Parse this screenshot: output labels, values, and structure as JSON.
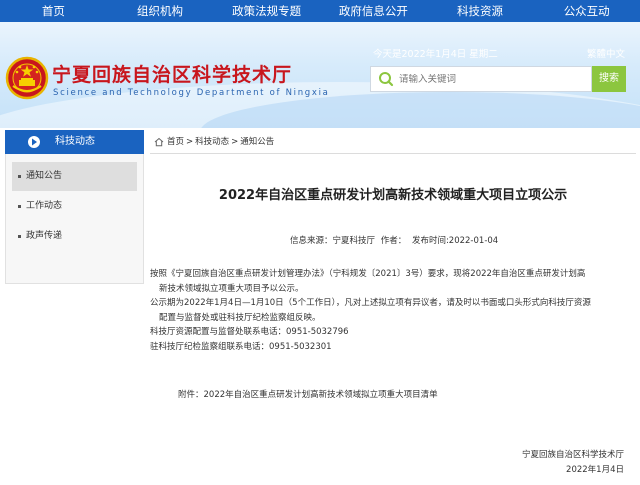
{
  "nav": {
    "items": [
      "首页",
      "组织机构",
      "政策法规专题",
      "政府信息公开",
      "科技资源",
      "公众互动"
    ]
  },
  "header": {
    "site_title": "宁夏回族自治区科学技术厅",
    "site_subtitle": "Science and Technology Department of Ningxia",
    "date_text": "今天是2022年1月4日 星期二",
    "lang_link": "繁體中文",
    "search_placeholder": "请输入关键词",
    "search_button": "搜索"
  },
  "sidebar": {
    "title": "科技动态",
    "items": [
      {
        "label": "通知公告",
        "active": true
      },
      {
        "label": "工作动态",
        "active": false
      },
      {
        "label": "政声传递",
        "active": false
      }
    ]
  },
  "breadcrumb": {
    "items": [
      "首页",
      "科技动态",
      "通知公告"
    ],
    "separator": ">"
  },
  "article": {
    "title": "2022年自治区重点研发计划高新技术领域重大项目立项公示",
    "source": "信息来源：宁夏科技厅",
    "author": "作者：",
    "published": "发布时间:2022-01-04",
    "para1_line1": "按照《宁夏回族自治区重点研发计划管理办法》（宁科规发〔2021〕3号）要求，现将2022年自治区重点研发计划高",
    "para1_line2": "新技术领域拟立项重大项目予以公示。",
    "para2_line1": "公示期为2022年1月4日—1月10日（5个工作日），凡对上述拟立项有异议者，请及时以书面或口头形式向科技厅资源",
    "para2_line2": "配置与监督处或驻科技厅纪检监察组反映。",
    "contact1": "科技厅资源配置与监督处联系电话：0951-5032796",
    "contact2": "驻科技厅纪检监察组联系电话：0951-5032301",
    "attachment": "附件：2022年自治区重点研发计划高新技术领域拟立项重大项目清单",
    "sign_org": "宁夏回族自治区科学技术厅",
    "sign_date": "2022年1月4日"
  },
  "colors": {
    "nav_blue": "#1a63c0",
    "title_red": "#c8161d",
    "search_green": "#8cc63f"
  }
}
